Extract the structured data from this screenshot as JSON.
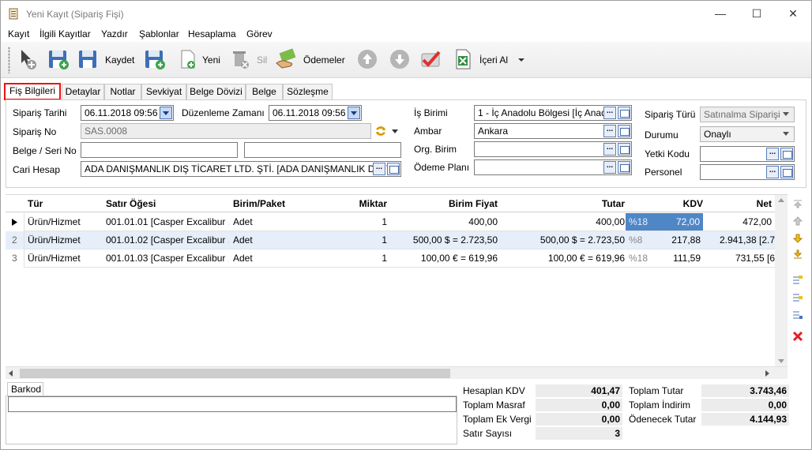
{
  "window": {
    "title": "Yeni Kayıt (Sipariş Fişi)"
  },
  "menu": [
    "Kayıt",
    "İlgili Kayıtlar",
    "Yazdır",
    "Şablonlar",
    "Hesaplama",
    "Görev"
  ],
  "toolbar": {
    "kaydet": "Kaydet",
    "yeni": "Yeni",
    "sil": "Sil",
    "odemeler": "Ödemeler",
    "iceri_al": "İçeri Al"
  },
  "tabs": [
    "Fiş Bilgileri",
    "Detaylar",
    "Notlar",
    "Sevkiyat",
    "Belge Dövizi",
    "Belge",
    "Sözleşme"
  ],
  "form": {
    "siparis_tarihi_label": "Sipariş Tarihi",
    "siparis_tarihi": "06.11.2018 09:56",
    "duzenleme_label": "Düzenleme Zamanı",
    "duzenleme": "06.11.2018 09:56",
    "siparis_no_label": "Sipariş No",
    "siparis_no": "SAS.0008",
    "belge_label": "Belge / Seri No",
    "belge": "",
    "seri": "",
    "cari_label": "Cari Hesap",
    "cari": "ADA DANIŞMANLIK DIŞ TİCARET LTD. ŞTİ. [ADA DANIŞMANLIK DIŞ T",
    "is_birimi_label": "İş Birimi",
    "is_birimi": "1 - İç Anadolu Bölgesi [İç Anad",
    "ambar_label": "Ambar",
    "ambar": "Ankara",
    "org_label": "Org. Birim",
    "org": "",
    "odeme_label": "Ödeme Planı",
    "odeme": "",
    "siparis_turu_label": "Sipariş Türü",
    "siparis_turu": "Satınalma Siparişi",
    "durumu_label": "Durumu",
    "durumu": "Onaylı",
    "yetki_label": "Yetki Kodu",
    "yetki": "",
    "personel_label": "Personel",
    "personel": ""
  },
  "grid": {
    "headers": [
      "Tür",
      "Satır Öğesi",
      "Birim/Paket",
      "Miktar",
      "Birim Fiyat",
      "Tutar",
      "KDV",
      "Net"
    ],
    "rows": [
      {
        "num": "",
        "tur": "Ürün/Hizmet",
        "oge": "001.01.01 [Casper Excalibur ...",
        "birim": "Adet",
        "miktar": "1",
        "fiyat": "400,00",
        "tutar": "400,00",
        "kdv_oran": "%18",
        "kdv": "72,00",
        "net": "472,00"
      },
      {
        "num": "2",
        "tur": "Ürün/Hizmet",
        "oge": "001.01.02 [Casper Excalibur ...",
        "birim": "Adet",
        "miktar": "1",
        "fiyat": "500,00 $ = 2.723,50",
        "tutar": "500,00 $ = 2.723,50",
        "kdv_oran": "%8",
        "kdv": "217,88",
        "net": "2.941,38 [2.7"
      },
      {
        "num": "3",
        "tur": "Ürün/Hizmet",
        "oge": "001.01.03 [Casper Excalibur ...",
        "birim": "Adet",
        "miktar": "1",
        "fiyat": "100,00 € = 619,96",
        "tutar": "100,00 € = 619,96",
        "kdv_oran": "%18",
        "kdv": "111,59",
        "net": "731,55 [6"
      }
    ]
  },
  "barkod": {
    "tab": "Barkod",
    "value": ""
  },
  "totals": {
    "hesaplan_kdv_label": "Hesaplan KDV",
    "hesaplan_kdv": "401,47",
    "masraf_label": "Toplam Masraf",
    "masraf": "0,00",
    "ek_vergi_label": "Toplam Ek Vergi",
    "ek_vergi": "0,00",
    "satir_label": "Satır Sayısı",
    "satir": "3",
    "toplam_tutar_label": "Toplam Tutar",
    "toplam_tutar": "3.743,46",
    "indirim_label": "Toplam İndirim",
    "indirim": "0,00",
    "odenecek_label": "Ödenecek Tutar",
    "odenecek": "4.144,93"
  },
  "colors": {
    "accent": "#e11111",
    "kdv_highlight": "#4f86c6",
    "row_alt": "#e6eef9"
  }
}
